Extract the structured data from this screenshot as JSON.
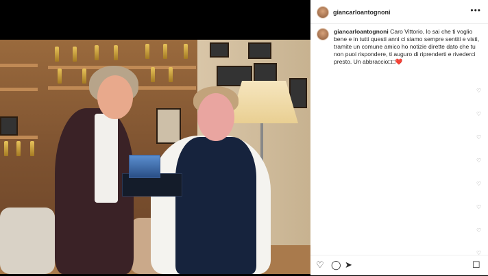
{
  "post": {
    "username": "giancarloantognoni",
    "caption_user": "giancarloantognoni",
    "caption_text": " Caro Vittorio, lo sai che ti voglio bene e in tutti questi anni ci siamo sempre sentiti e visti, tramite un comune amico ho notizie dirette dato che tu non puoi rispondere, ti auguro di riprenderti e rivederci presto. Un abbraccio□□❤️"
  },
  "icons": {
    "more": "•••",
    "heart": "♡",
    "comment": "◯",
    "share": "➤",
    "bookmark": "☐",
    "side_heart": "♡"
  },
  "colors": {
    "text": "#262626",
    "muted": "#8e8e8e"
  }
}
